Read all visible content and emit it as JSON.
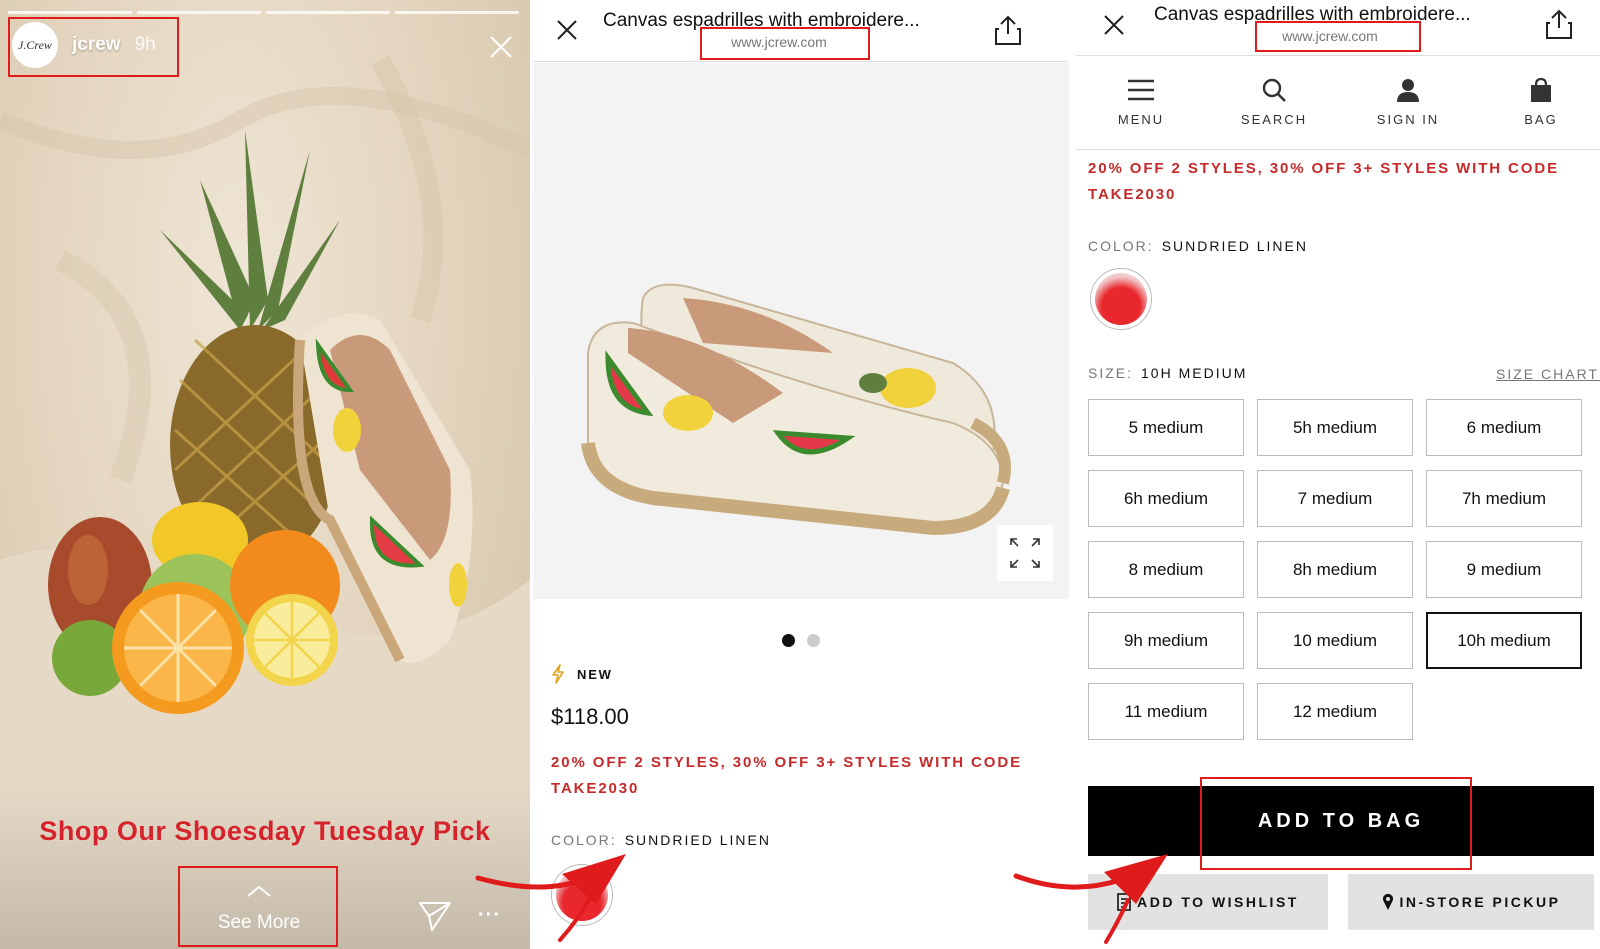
{
  "story": {
    "avatar_text": "J.Crew",
    "username": "jcrew",
    "time": "9h",
    "headline": "Shop Our Shoesday Tuesday Pick",
    "see_more": "See More"
  },
  "panel2": {
    "title": "Canvas espadrilles with embroidere...",
    "url": "www.jcrew.com",
    "badge": "NEW",
    "price": "$118.00",
    "promo": "20% OFF 2 STYLES, 30% OFF 3+ STYLES WITH CODE TAKE2030",
    "color_label": "COLOR:",
    "color_value": "SUNDRIED LINEN",
    "image_dots": 2,
    "active_dot": 0
  },
  "panel3": {
    "title": "Canvas espadrilles with embroidere...",
    "url": "www.jcrew.com",
    "nav": [
      {
        "label": "MENU",
        "icon": "menu-icon"
      },
      {
        "label": "SEARCH",
        "icon": "search-icon"
      },
      {
        "label": "SIGN IN",
        "icon": "user-icon"
      },
      {
        "label": "BAG",
        "icon": "bag-icon"
      }
    ],
    "promo": "20% OFF 2 STYLES, 30% OFF 3+ STYLES WITH CODE TAKE2030",
    "color_label": "COLOR:",
    "color_value": "SUNDRIED LINEN",
    "size_label": "SIZE:",
    "size_value": "10H MEDIUM",
    "size_charts": "SIZE CHARTS",
    "sizes": [
      "5 medium",
      "5h medium",
      "6 medium",
      "6h medium",
      "7 medium",
      "7h medium",
      "8 medium",
      "8h medium",
      "9 medium",
      "9h medium",
      "10 medium",
      "10h medium",
      "11 medium",
      "12 medium"
    ],
    "selected_size": "10h medium",
    "add_to_bag": "ADD TO BAG",
    "add_to_wishlist": "ADD TO WISHLIST",
    "in_store_pickup": "IN-STORE PICKUP"
  },
  "colors": {
    "accent_red": "#d6232b",
    "promo_red": "#c62a2a",
    "highlight_box": "#e01b1b",
    "button_black": "#000000"
  }
}
